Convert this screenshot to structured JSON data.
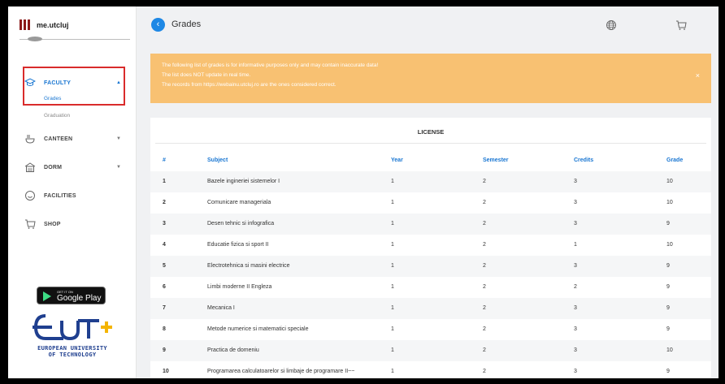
{
  "brand": {
    "name": "me.utcluj"
  },
  "header": {
    "title": "Grades"
  },
  "sidebar": {
    "faculty": {
      "label": "FACULTY",
      "sub_items": [
        "Grades",
        "Graduation"
      ]
    },
    "canteen": {
      "label": "CANTEEN"
    },
    "dorm": {
      "label": "DORM"
    },
    "facilities": {
      "label": "FACILITIES"
    },
    "shop": {
      "label": "SHOP"
    },
    "google_play": {
      "small": "GET IT ON",
      "big": "Google Play"
    },
    "eut": {
      "line1": "EUROPEAN UNIVERSITY",
      "line2": "OF TECHNOLOGY"
    }
  },
  "banner": {
    "lines": [
      "The following list of grades is for informative purposes only and may contain inaccurate data!",
      "The list does NOT update in real time.",
      "The records from https://webainu.utcluj.ro are the ones considered correct."
    ],
    "close": "×",
    "color": "#f8c172"
  },
  "table": {
    "title": "LICENSE",
    "headers": [
      "#",
      "Subject",
      "Year",
      "Semester",
      "Credits",
      "Grade"
    ],
    "rows": [
      [
        "1",
        "Bazele ingineriei sistemelor I",
        "1",
        "2",
        "3",
        "10"
      ],
      [
        "2",
        "Comunicare manageriala",
        "1",
        "2",
        "3",
        "10"
      ],
      [
        "3",
        "Desen tehnic si infografica",
        "1",
        "2",
        "3",
        "9"
      ],
      [
        "4",
        "Educatie fizica si sport II",
        "1",
        "2",
        "1",
        "10"
      ],
      [
        "5",
        "Electrotehnica si masini electrice",
        "1",
        "2",
        "3",
        "9"
      ],
      [
        "6",
        "Limbi moderne II Engleza",
        "1",
        "2",
        "2",
        "9"
      ],
      [
        "7",
        "Mecanica I",
        "1",
        "2",
        "3",
        "9"
      ],
      [
        "8",
        "Metode numerice si matematici speciale",
        "1",
        "2",
        "3",
        "9"
      ],
      [
        "9",
        "Practica de domeniu",
        "1",
        "2",
        "3",
        "10"
      ],
      [
        "10",
        "Programarea calculatoarelor si limbaje de programare II~~",
        "1",
        "2",
        "3",
        "9"
      ]
    ]
  },
  "colors": {
    "accent": "#1976d2",
    "brand": "#8b1a1a",
    "highlight": "#d92b2b"
  },
  "icons": {
    "faculty": "graduation-cap-icon",
    "canteen": "bowl-icon",
    "dorm": "building-icon",
    "facilities": "smiley-icon",
    "shop": "cart-icon",
    "language": "globe-icon",
    "cart": "cart-icon"
  }
}
